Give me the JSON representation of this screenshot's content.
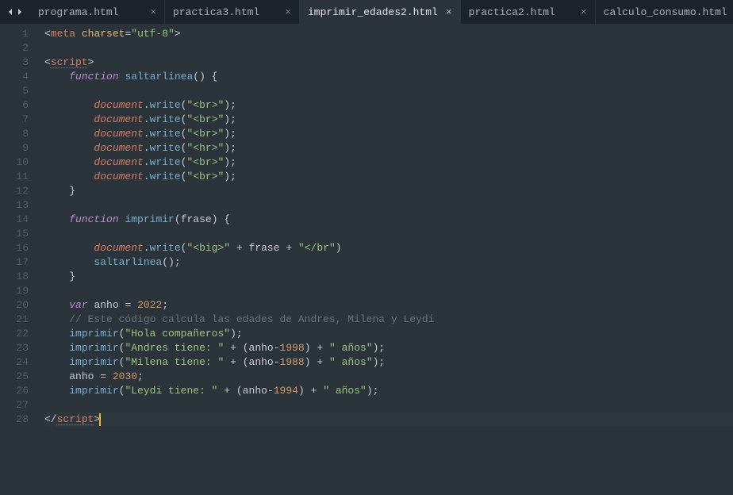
{
  "tabs": [
    {
      "label": "programa.html",
      "active": false
    },
    {
      "label": "practica3.html",
      "active": false
    },
    {
      "label": "imprimir_edades2.html",
      "active": true
    },
    {
      "label": "practica2.html",
      "active": false
    },
    {
      "label": "calculo_consumo.html",
      "active": false
    }
  ],
  "line_count": 28,
  "code_lines": {
    "l1": [
      [
        "punct",
        "<"
      ],
      [
        "tag",
        "meta"
      ],
      [
        "plain",
        " "
      ],
      [
        "attr",
        "charset"
      ],
      [
        "punct",
        "="
      ],
      [
        "str",
        "\"utf-8\""
      ],
      [
        "punct",
        ">"
      ]
    ],
    "l2": [],
    "l3": [
      [
        "punct",
        "<"
      ],
      [
        "tag-dotted",
        "script"
      ],
      [
        "punct",
        ">"
      ]
    ],
    "l4": [
      [
        "indent",
        "    "
      ],
      [
        "kw",
        "function"
      ],
      [
        "plain",
        " "
      ],
      [
        "fn",
        "saltarlinea"
      ],
      [
        "punct",
        "() {"
      ]
    ],
    "l5": [],
    "l6": [
      [
        "indent",
        "        "
      ],
      [
        "obj",
        "document"
      ],
      [
        "punct",
        "."
      ],
      [
        "fn",
        "write"
      ],
      [
        "punct",
        "("
      ],
      [
        "str",
        "\"<br>\""
      ],
      [
        "punct",
        ");"
      ]
    ],
    "l7": [
      [
        "indent",
        "        "
      ],
      [
        "obj",
        "document"
      ],
      [
        "punct",
        "."
      ],
      [
        "fn",
        "write"
      ],
      [
        "punct",
        "("
      ],
      [
        "str",
        "\"<br>\""
      ],
      [
        "punct",
        ");"
      ]
    ],
    "l8": [
      [
        "indent",
        "        "
      ],
      [
        "obj",
        "document"
      ],
      [
        "punct",
        "."
      ],
      [
        "fn",
        "write"
      ],
      [
        "punct",
        "("
      ],
      [
        "str",
        "\"<br>\""
      ],
      [
        "punct",
        ");"
      ]
    ],
    "l9": [
      [
        "indent",
        "        "
      ],
      [
        "obj",
        "document"
      ],
      [
        "punct",
        "."
      ],
      [
        "fn",
        "write"
      ],
      [
        "punct",
        "("
      ],
      [
        "str",
        "\"<hr>\""
      ],
      [
        "punct",
        ");"
      ]
    ],
    "l10": [
      [
        "indent",
        "        "
      ],
      [
        "obj",
        "document"
      ],
      [
        "punct",
        "."
      ],
      [
        "fn",
        "write"
      ],
      [
        "punct",
        "("
      ],
      [
        "str",
        "\"<br>\""
      ],
      [
        "punct",
        ");"
      ]
    ],
    "l11": [
      [
        "indent",
        "        "
      ],
      [
        "obj",
        "document"
      ],
      [
        "punct",
        "."
      ],
      [
        "fn",
        "write"
      ],
      [
        "punct",
        "("
      ],
      [
        "str",
        "\"<br>\""
      ],
      [
        "punct",
        ");"
      ]
    ],
    "l12": [
      [
        "indent",
        "    "
      ],
      [
        "punct",
        "}"
      ]
    ],
    "l13": [],
    "l14": [
      [
        "indent",
        "    "
      ],
      [
        "kw",
        "function"
      ],
      [
        "plain",
        " "
      ],
      [
        "fn",
        "imprimir"
      ],
      [
        "punct",
        "("
      ],
      [
        "var",
        "frase"
      ],
      [
        "punct",
        ") {"
      ]
    ],
    "l15": [],
    "l16": [
      [
        "indent",
        "        "
      ],
      [
        "obj",
        "document"
      ],
      [
        "punct",
        "."
      ],
      [
        "fn",
        "write"
      ],
      [
        "punct",
        "("
      ],
      [
        "str",
        "\"<big>\""
      ],
      [
        "plain",
        " "
      ],
      [
        "punct",
        "+"
      ],
      [
        "plain",
        " "
      ],
      [
        "var",
        "frase"
      ],
      [
        "plain",
        " "
      ],
      [
        "punct",
        "+"
      ],
      [
        "plain",
        " "
      ],
      [
        "str",
        "\"</br\""
      ],
      [
        "punct",
        ")"
      ]
    ],
    "l17": [
      [
        "indent",
        "        "
      ],
      [
        "fn",
        "saltarlinea"
      ],
      [
        "punct",
        "();"
      ]
    ],
    "l18": [
      [
        "indent",
        "    "
      ],
      [
        "punct",
        "}"
      ]
    ],
    "l19": [],
    "l20": [
      [
        "indent",
        "    "
      ],
      [
        "kw",
        "var"
      ],
      [
        "plain",
        " "
      ],
      [
        "var",
        "anho"
      ],
      [
        "plain",
        " "
      ],
      [
        "punct",
        "="
      ],
      [
        "plain",
        " "
      ],
      [
        "num",
        "2022"
      ],
      [
        "punct",
        ";"
      ]
    ],
    "l21": [
      [
        "indent",
        "    "
      ],
      [
        "cmt",
        "// Este código calcula las edades de Andres, Milena y Leydi"
      ]
    ],
    "l22": [
      [
        "indent",
        "    "
      ],
      [
        "fn",
        "imprimir"
      ],
      [
        "punct",
        "("
      ],
      [
        "str",
        "\"Hola compañeros\""
      ],
      [
        "punct",
        ");"
      ]
    ],
    "l23": [
      [
        "indent",
        "    "
      ],
      [
        "fn",
        "imprimir"
      ],
      [
        "punct",
        "("
      ],
      [
        "str",
        "\"Andres tiene: \""
      ],
      [
        "plain",
        " "
      ],
      [
        "punct",
        "+"
      ],
      [
        "plain",
        " ("
      ],
      [
        "var",
        "anho"
      ],
      [
        "punct",
        "-"
      ],
      [
        "num",
        "1998"
      ],
      [
        "punct",
        ")"
      ],
      [
        "plain",
        " "
      ],
      [
        "punct",
        "+"
      ],
      [
        "plain",
        " "
      ],
      [
        "str",
        "\" años\""
      ],
      [
        "punct",
        ");"
      ]
    ],
    "l24": [
      [
        "indent",
        "    "
      ],
      [
        "fn",
        "imprimir"
      ],
      [
        "punct",
        "("
      ],
      [
        "str",
        "\"Milena tiene: \""
      ],
      [
        "plain",
        " "
      ],
      [
        "punct",
        "+"
      ],
      [
        "plain",
        " ("
      ],
      [
        "var",
        "anho"
      ],
      [
        "punct",
        "-"
      ],
      [
        "num",
        "1988"
      ],
      [
        "punct",
        ")"
      ],
      [
        "plain",
        " "
      ],
      [
        "punct",
        "+"
      ],
      [
        "plain",
        " "
      ],
      [
        "str",
        "\" años\""
      ],
      [
        "punct",
        ");"
      ]
    ],
    "l25": [
      [
        "indent",
        "    "
      ],
      [
        "var",
        "anho"
      ],
      [
        "plain",
        " "
      ],
      [
        "punct",
        "="
      ],
      [
        "plain",
        " "
      ],
      [
        "num",
        "2030"
      ],
      [
        "punct",
        ";"
      ]
    ],
    "l26": [
      [
        "indent",
        "    "
      ],
      [
        "fn",
        "imprimir"
      ],
      [
        "punct",
        "("
      ],
      [
        "str",
        "\"Leydi tiene: \""
      ],
      [
        "plain",
        " "
      ],
      [
        "punct",
        "+"
      ],
      [
        "plain",
        " ("
      ],
      [
        "var",
        "anho"
      ],
      [
        "punct",
        "-"
      ],
      [
        "num",
        "1994"
      ],
      [
        "punct",
        ")"
      ],
      [
        "plain",
        " "
      ],
      [
        "punct",
        "+"
      ],
      [
        "plain",
        " "
      ],
      [
        "str",
        "\" años\""
      ],
      [
        "punct",
        ");"
      ]
    ],
    "l27": [],
    "l28": [
      [
        "punct",
        "</"
      ],
      [
        "tag-dotted",
        "script"
      ],
      [
        "punct-cursor",
        ">"
      ]
    ]
  },
  "cursor_line": 28
}
